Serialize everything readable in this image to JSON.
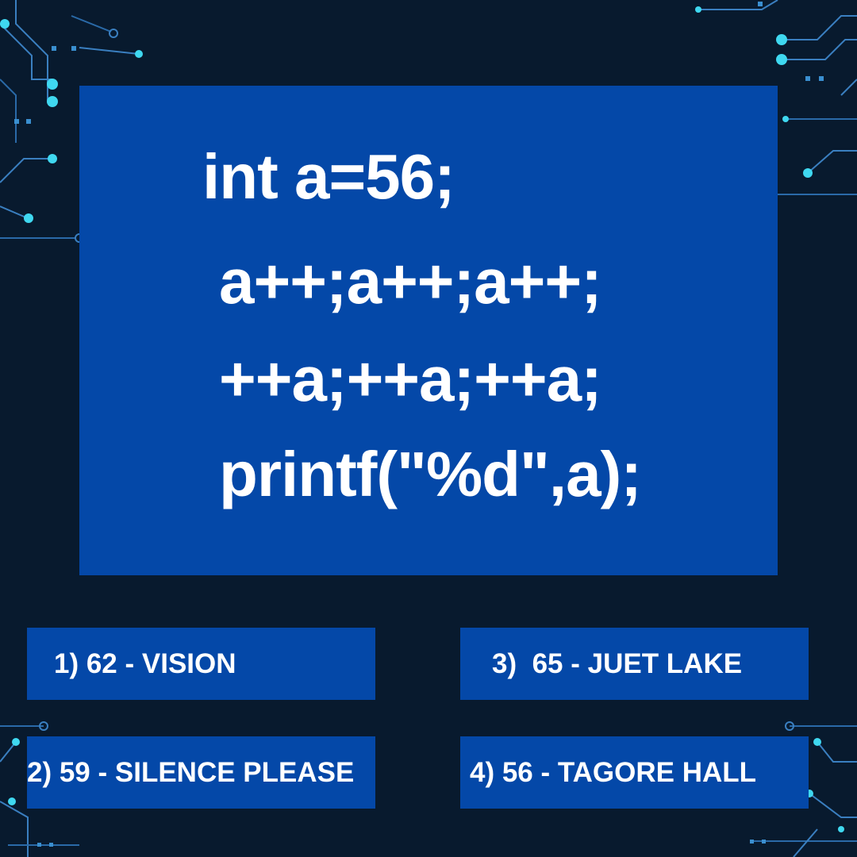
{
  "question": {
    "code_lines": [
      "int a=56;",
      "a++;a++;a++;",
      "++a;++a;++a;",
      "printf(\"%d\",a);"
    ]
  },
  "options": [
    {
      "label": "1) 62 - VISION"
    },
    {
      "label": "2) 59 - SILENCE PLEASE"
    },
    {
      "label": "3)  65 - JUET LAKE"
    },
    {
      "label": "4) 56 - TAGORE HALL"
    }
  ],
  "colors": {
    "background": "#081a2e",
    "panel": "#0448a8",
    "text": "#ffffff",
    "circuit_cyan": "#3fd8f0",
    "circuit_blue": "#3a7fc0"
  }
}
